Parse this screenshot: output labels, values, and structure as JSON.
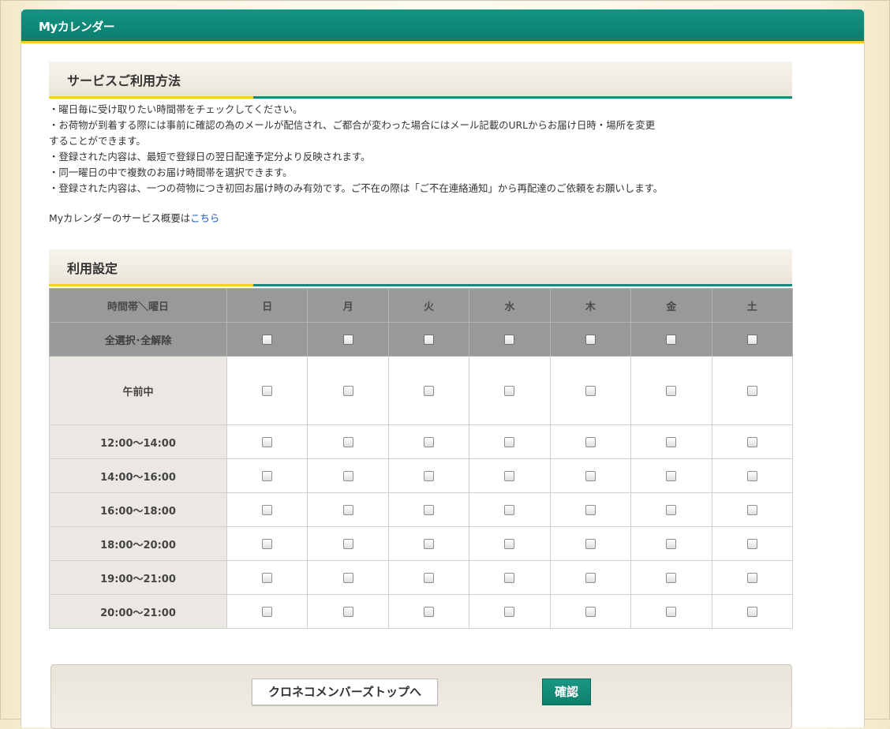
{
  "header": {
    "title": "Myカレンダー"
  },
  "usage": {
    "heading": "サービスご利用方法",
    "notes": [
      "・曜日毎に受け取りたい時間帯をチェックしてください。",
      "・お荷物が到着する際には事前に確認の為のメールが配信され、ご都合が変わった場合にはメール記載のURLからお届け日時・場所を変更",
      "することができます。",
      "・登録された内容は、最短で登録日の翌日配達予定分より反映されます。",
      "・同一曜日の中で複数のお届け時間帯を選択できます。",
      "・登録された内容は、一つの荷物につき初回お届け時のみ有効です。ご不在の際は「ご不在連絡通知」から再配達のご依頼をお願いします。"
    ],
    "overview_text": "Myカレンダーのサービス概要は",
    "overview_link": "こちら"
  },
  "settings": {
    "heading": "利用設定",
    "corner_label": "時間帯＼曜日",
    "select_all_label": "全選択･全解除",
    "days": [
      "日",
      "月",
      "火",
      "水",
      "木",
      "金",
      "土"
    ],
    "slots": [
      "午前中",
      "12:00〜14:00",
      "14:00〜16:00",
      "16:00〜18:00",
      "18:00〜20:00",
      "19:00〜21:00",
      "20:00〜21:00"
    ]
  },
  "footer": {
    "top_button": "クロネコメンバーズトップへ",
    "confirm_button": "確認"
  },
  "colors": {
    "brand_green": "#0b7e6d",
    "accent_yellow": "#f2d21c",
    "link_blue": "#1f58b8"
  }
}
